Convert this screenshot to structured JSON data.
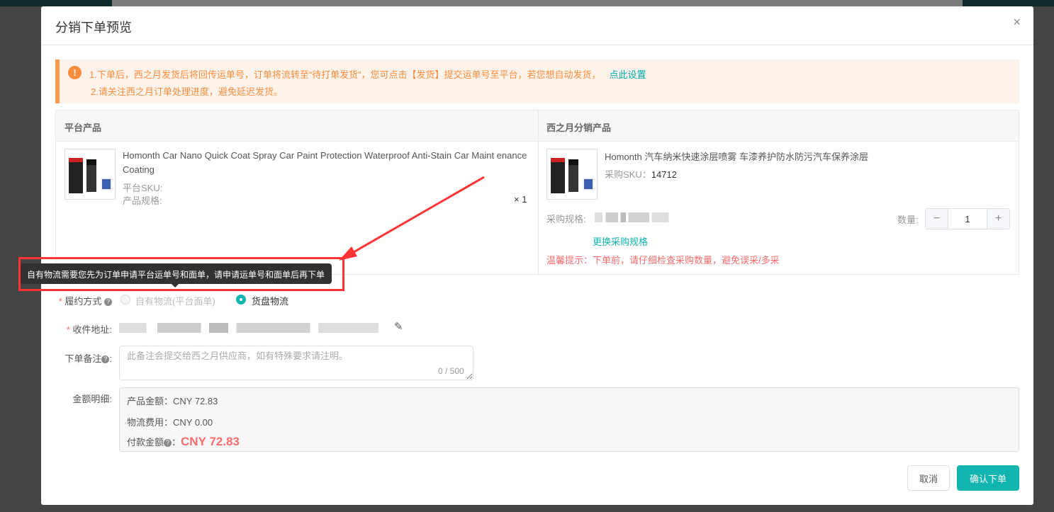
{
  "modal": {
    "title": "分销下单预览",
    "close_label": "×"
  },
  "alert": {
    "line1": "1.下单后，西之月发货后将回传运单号，订单将流转至“待打单发货”，您可点击【发货】提交运单号至平台，若您想自动发货，",
    "link": "点此设置",
    "line2": "2.请关注西之月订单处理进度，避免延迟发货。"
  },
  "table": {
    "col_platform": "平台产品",
    "col_distribution": "西之月分销产品",
    "platform_product": {
      "title": "Homonth Car Nano Quick Coat Spray Car Paint Protection Waterproof Anti-Stain Car Maint enance Coating",
      "sku_label": "平台SKU:",
      "spec_label": "产品规格:",
      "quantity": "× 1"
    },
    "dist_product": {
      "title": "Homonth 汽车纳米快速涂层喷雾 车漆养护防水防污汽车保养涂层",
      "sku_label": "采购SKU：",
      "sku": "14712",
      "spec_label": "采购规格:",
      "qty_label": "数量:",
      "qty": "1",
      "minus": "−",
      "plus": "+",
      "change_spec": "更换采购规格",
      "warning": "温馨提示：下单前，请仔细检查采购数量，避免误采/多采"
    }
  },
  "tooltip": "自有物流需要您先为订单申请平台运单号和面单，请申请运单号和面单后再下单",
  "form": {
    "fulfill_label": "履约方式",
    "opt_own": "自有物流(平台面单)",
    "opt_cargo": "货盘物流",
    "address_label": "收件地址:",
    "remark_label": "下单备注",
    "remark_placeholder": "此备注会提交给西之月供应商，如有特殊要求请注明。",
    "remark_count": "0 / 500",
    "amount_label": "金额明细:",
    "product_amount": "产品金额：CNY 72.83",
    "shipping": "物流费用：CNY 0.00",
    "pay_label": "付款金额",
    "pay_value": "CNY 72.83"
  },
  "footer": {
    "cancel": "取消",
    "confirm": "确认下单"
  },
  "colors": {
    "accent": "#12b5b0",
    "danger": "#f56c6c",
    "warn": "#fa8c3c"
  }
}
